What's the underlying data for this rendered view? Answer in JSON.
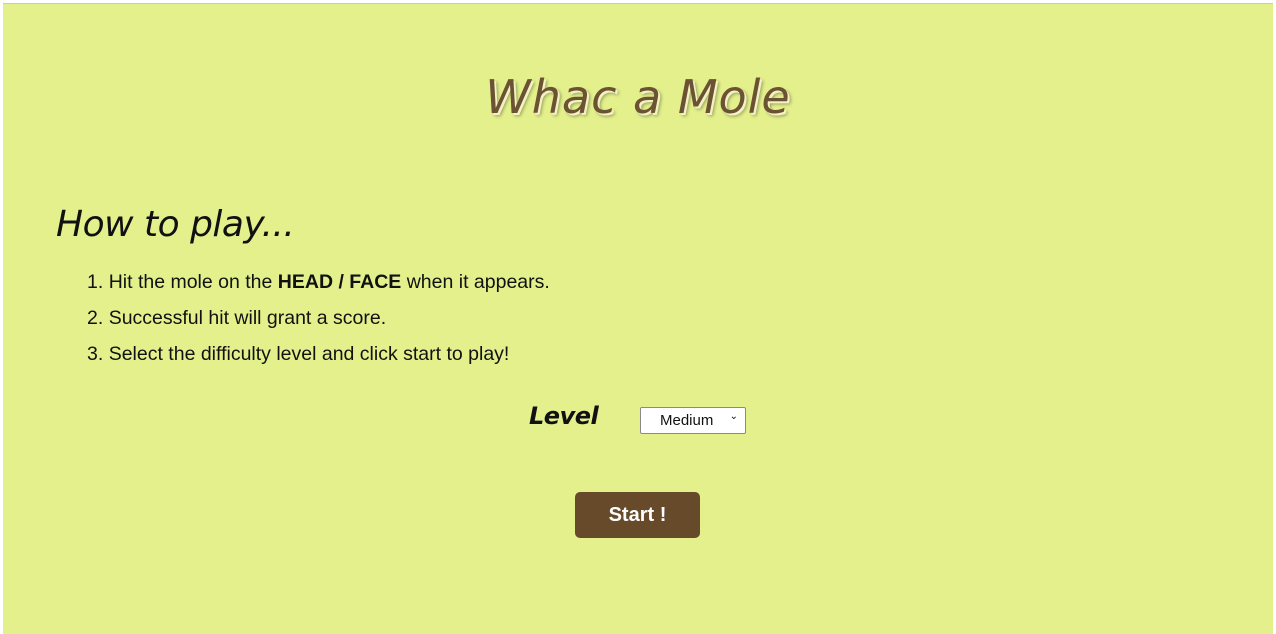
{
  "game": {
    "title": "Whac a Mole",
    "howto_heading": "How to play...",
    "steps": [
      {
        "number": "1.",
        "before": "Hit the mole on the ",
        "bold": "HEAD / FACE",
        "after": " when it appears."
      },
      {
        "number": "2.",
        "text": "Successful hit will grant a score."
      },
      {
        "number": "3.",
        "text": "Select the difficulty level and click start to play!"
      }
    ],
    "level": {
      "label": "Level",
      "selected": "Medium",
      "chevron_icon": "chevron-down-icon"
    },
    "start_label": "Start !"
  },
  "colors": {
    "background": "#e3f08b",
    "title": "#6b5232",
    "button": "#664a29",
    "button_text": "#ffffff"
  }
}
